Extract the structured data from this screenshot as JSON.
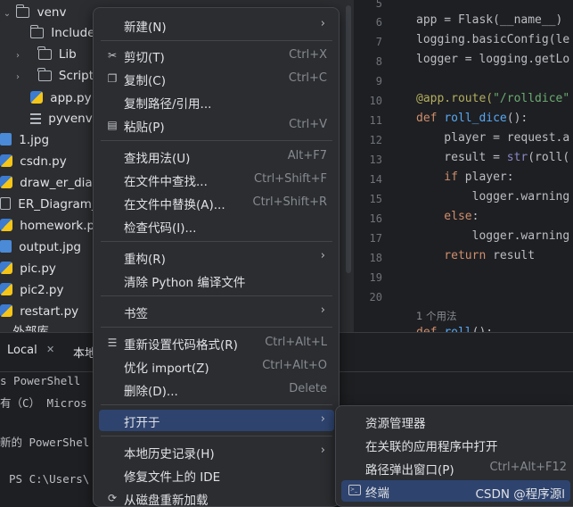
{
  "project_tree": {
    "items": [
      {
        "label": "venv",
        "icon": "folder-icon",
        "expanded": true
      },
      {
        "label": "Include",
        "icon": "folder-icon"
      },
      {
        "label": "Lib",
        "icon": "folder-icon"
      },
      {
        "label": "Scripts",
        "icon": "folder-icon"
      },
      {
        "label": "app.py",
        "icon": "python-file-icon"
      },
      {
        "label": "pyvenv.c",
        "icon": "config-file-icon"
      },
      {
        "label": "1.jpg",
        "icon": "image-file-icon"
      },
      {
        "label": "csdn.py",
        "icon": "python-file-icon"
      },
      {
        "label": "draw_er_diagra",
        "icon": "python-file-icon"
      },
      {
        "label": "ER_Diagram_IT",
        "icon": "file-icon"
      },
      {
        "label": "homework.py",
        "icon": "python-file-icon"
      },
      {
        "label": "output.jpg",
        "icon": "image-file-icon"
      },
      {
        "label": "pic.py",
        "icon": "python-file-icon"
      },
      {
        "label": "pic2.py",
        "icon": "python-file-icon"
      },
      {
        "label": "restart.py",
        "icon": "python-file-icon"
      },
      {
        "label": "外部库",
        "icon": "library-icon"
      }
    ]
  },
  "editor": {
    "line_numbers": [
      "5",
      "6",
      "7",
      "8",
      "9",
      "10",
      "11",
      "12",
      "13",
      "14",
      "15",
      "16",
      "17",
      "18",
      "19",
      "20"
    ],
    "code": {
      "l5": "app = Flask(__name__)",
      "l6": "logging.basicConfig(le",
      "l7": "logger = logging.getLo",
      "l9_dec": "@app.route(",
      "l9_str": "\"/rolldice\"",
      "l10_kw": "def ",
      "l10_fn": "roll_dice",
      "l10_rest": "():",
      "l11": "    player = request.a",
      "l12_a": "    result = ",
      "l12_bi": "str",
      "l12_b": "(roll(",
      "l13_kw": "    if ",
      "l13_rest": "player:",
      "l14": "        logger.warning",
      "l15_kw": "    else",
      "l15_rest": ":",
      "l16": "        logger.warning",
      "l17_kw": "    return ",
      "l17_rest": "result",
      "l21_kw": "def ",
      "l21_fn": "roll",
      "l21_rest": "():"
    },
    "usages": "1 个用法"
  },
  "terminal": {
    "tabs": [
      {
        "label": "Local"
      },
      {
        "label": "本地"
      }
    ],
    "lines": [
      "s PowerShell",
      "有（C） Micros",
      "",
      "新的 PowerShel",
      "",
      "PS C:\\Users\\"
    ]
  },
  "context_menu": {
    "items": [
      {
        "label": "新建(N)",
        "shortcut": "",
        "submenu": true,
        "icon": ""
      },
      {
        "label": "剪切(T)",
        "shortcut": "Ctrl+X",
        "submenu": false,
        "icon": "cut-icon"
      },
      {
        "label": "复制(C)",
        "shortcut": "Ctrl+C",
        "submenu": false,
        "icon": "copy-icon"
      },
      {
        "label": "复制路径/引用...",
        "shortcut": "",
        "submenu": false,
        "icon": ""
      },
      {
        "label": "粘贴(P)",
        "shortcut": "Ctrl+V",
        "submenu": false,
        "icon": "paste-icon"
      },
      {
        "label": "查找用法(U)",
        "shortcut": "Alt+F7",
        "submenu": false,
        "icon": ""
      },
      {
        "label": "在文件中查找...",
        "shortcut": "Ctrl+Shift+F",
        "submenu": false,
        "icon": ""
      },
      {
        "label": "在文件中替换(A)...",
        "shortcut": "Ctrl+Shift+R",
        "submenu": false,
        "icon": ""
      },
      {
        "label": "检查代码(I)...",
        "shortcut": "",
        "submenu": false,
        "icon": ""
      },
      {
        "label": "重构(R)",
        "shortcut": "",
        "submenu": true,
        "icon": ""
      },
      {
        "label": "清除 Python 编译文件",
        "shortcut": "",
        "submenu": false,
        "icon": ""
      },
      {
        "label": "书签",
        "shortcut": "",
        "submenu": true,
        "icon": ""
      },
      {
        "label": "重新设置代码格式(R)",
        "shortcut": "Ctrl+Alt+L",
        "submenu": false,
        "icon": "format-icon"
      },
      {
        "label": "优化 import(Z)",
        "shortcut": "Ctrl+Alt+O",
        "submenu": false,
        "icon": ""
      },
      {
        "label": "删除(D)...",
        "shortcut": "Delete",
        "submenu": false,
        "icon": ""
      },
      {
        "label": "打开于",
        "shortcut": "",
        "submenu": true,
        "icon": "",
        "selected": true
      },
      {
        "label": "本地历史记录(H)",
        "shortcut": "",
        "submenu": true,
        "icon": ""
      },
      {
        "label": "修复文件上的 IDE",
        "shortcut": "",
        "submenu": false,
        "icon": ""
      },
      {
        "label": "从磁盘重新加载",
        "shortcut": "",
        "submenu": false,
        "icon": "reload-icon"
      }
    ]
  },
  "submenu": {
    "items": [
      {
        "label": "资源管理器",
        "shortcut": ""
      },
      {
        "label": "在关联的应用程序中打开",
        "shortcut": ""
      },
      {
        "label": "路径弹出窗口(P)",
        "shortcut": "Ctrl+Alt+F12"
      },
      {
        "label": "终端",
        "shortcut": "",
        "selected": true,
        "icon": "terminal-icon"
      }
    ],
    "watermark": "CSDN @程序源l"
  },
  "colors": {
    "menu_bg": "#2b2d30",
    "selection": "#2e436e",
    "editor_bg": "#1e1f22"
  }
}
